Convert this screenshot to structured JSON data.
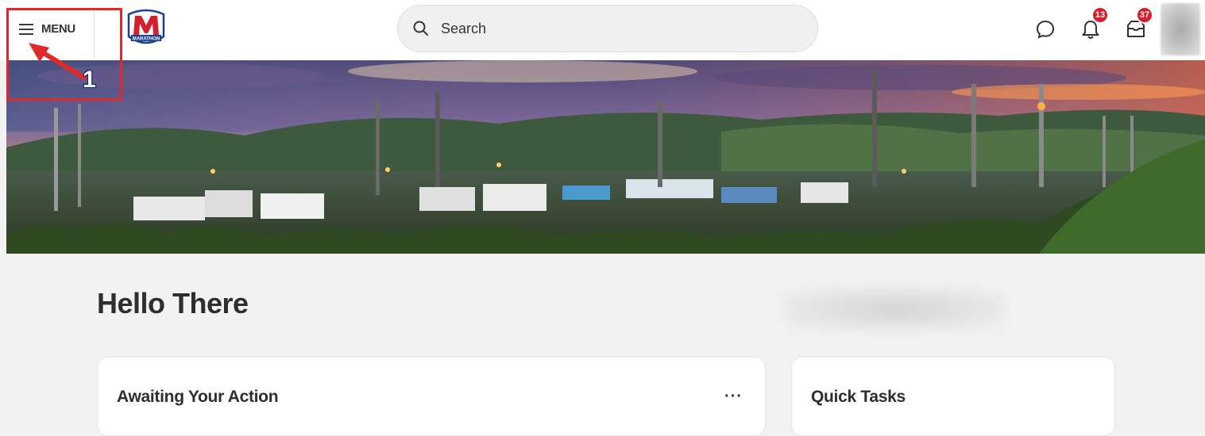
{
  "header": {
    "menu_label": "MENU",
    "logo_text": "MARATHON",
    "search_placeholder": "Search",
    "notifications_count": "13",
    "inbox_count": "37"
  },
  "annotation": {
    "step_number": "1",
    "color": "#e02a2a"
  },
  "main": {
    "greeting": "Hello There",
    "cards": [
      {
        "title": "Awaiting Your Action",
        "more_label": "···"
      },
      {
        "title": "Quick Tasks"
      }
    ]
  },
  "colors": {
    "brand_red": "#d4202c",
    "brand_blue": "#1a3f8f",
    "badge": "#d4202c",
    "background": "#f2f2f2"
  },
  "icons": {
    "menu": "hamburger-icon",
    "search": "search-icon",
    "chat": "chat-bubble-icon",
    "notifications": "bell-icon",
    "inbox": "inbox-icon"
  }
}
